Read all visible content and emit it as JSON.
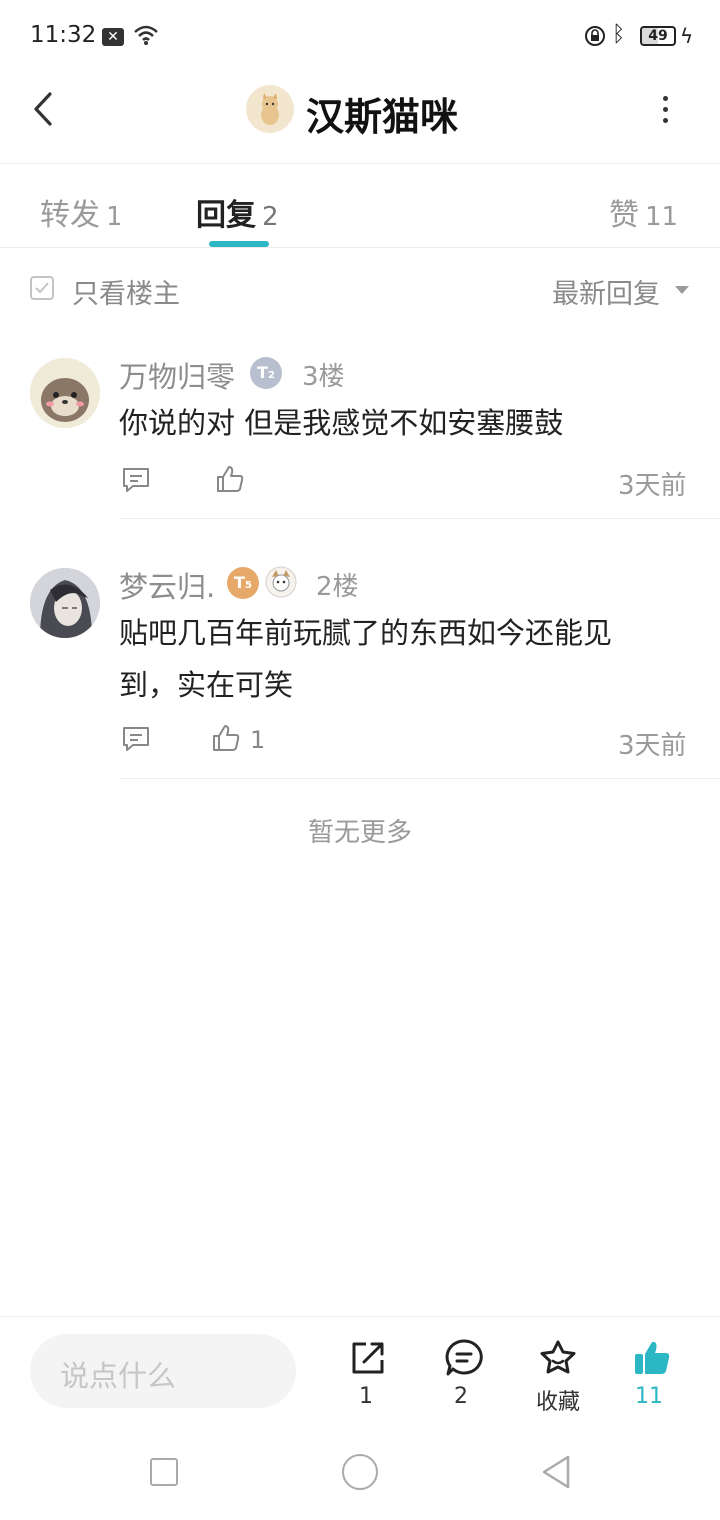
{
  "status_bar": {
    "time": "11:32",
    "battery": "49"
  },
  "header": {
    "title": "汉斯猫咪"
  },
  "tabs": [
    {
      "label": "转发",
      "count": "1"
    },
    {
      "label": "回复",
      "count": "2"
    },
    {
      "label": "赞",
      "count": "11"
    }
  ],
  "filter": {
    "label": "只看楼主",
    "sort": "最新回复"
  },
  "comments": [
    {
      "username": "万物归零",
      "badge": "T",
      "badge_sub": "2",
      "floor": "3楼",
      "text": "你说的对 但是我感觉不如安塞腰鼓",
      "time": "3天前",
      "likes": ""
    },
    {
      "username": "梦云归.",
      "badge": "T",
      "badge_sub": "5",
      "floor": "2楼",
      "text_line1": "贴吧几百年前玩腻了的东西如今还能见",
      "text_line2": "到，实在可笑",
      "time": "3天前",
      "likes": "1"
    }
  ],
  "no_more": "暂无更多",
  "bottom_bar": {
    "placeholder": "说点什么",
    "share_count": "1",
    "comment_count": "2",
    "favorite_label": "收藏",
    "like_count": "11"
  },
  "colors": {
    "accent": "#2bb7c4"
  }
}
